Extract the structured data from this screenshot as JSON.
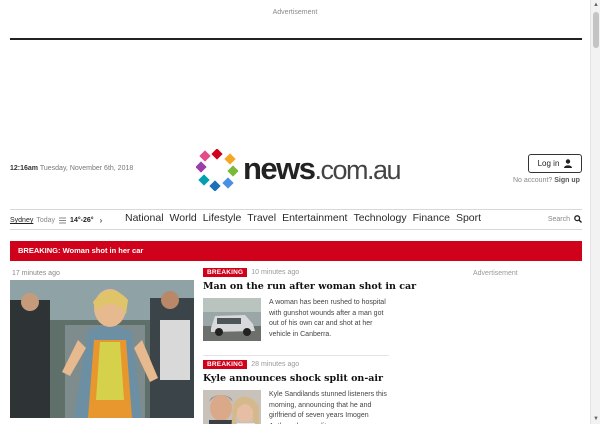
{
  "ads": {
    "top_label": "Advertisement",
    "side_label": "Advertisement"
  },
  "header": {
    "time": "12:16am",
    "date": "Tuesday, November 6th, 2018",
    "logo_brand": "news",
    "logo_tld": ".com.au",
    "login_label": "Log in",
    "no_account": "No account?",
    "signup_label": "Sign up"
  },
  "weather": {
    "city": "Sydney",
    "today": "Today",
    "temps": "14°-26°"
  },
  "nav": {
    "items": [
      "National",
      "World",
      "Lifestyle",
      "Travel",
      "Entertainment",
      "Technology",
      "Finance",
      "Sport"
    ],
    "search_label": "Search"
  },
  "breaking_bar": "BREAKING: Woman shot in her car",
  "hero": {
    "time": "17 minutes ago"
  },
  "stories": [
    {
      "badge": "BREAKING",
      "time": "10 minutes ago",
      "headline": "Man on the run after woman shot in car",
      "summary": "A woman has been rushed to hospital with gunshot wounds after a man got out of his own car and shot at her vehicle in Canberra."
    },
    {
      "badge": "BREAKING",
      "time": "28 minutes ago",
      "headline": "Kyle announces shock split on-air",
      "summary": "Kyle Sandilands stunned listeners this morning, announcing that he and girlfriend of seven years Imogen Anthony have split up."
    }
  ],
  "colors": {
    "breaking_red": "#d0021b",
    "text_dark": "#222222"
  },
  "icons": {
    "user": "user-icon",
    "search": "search-icon",
    "chevron": "chevron-right-icon",
    "weather": "weather-icon"
  }
}
